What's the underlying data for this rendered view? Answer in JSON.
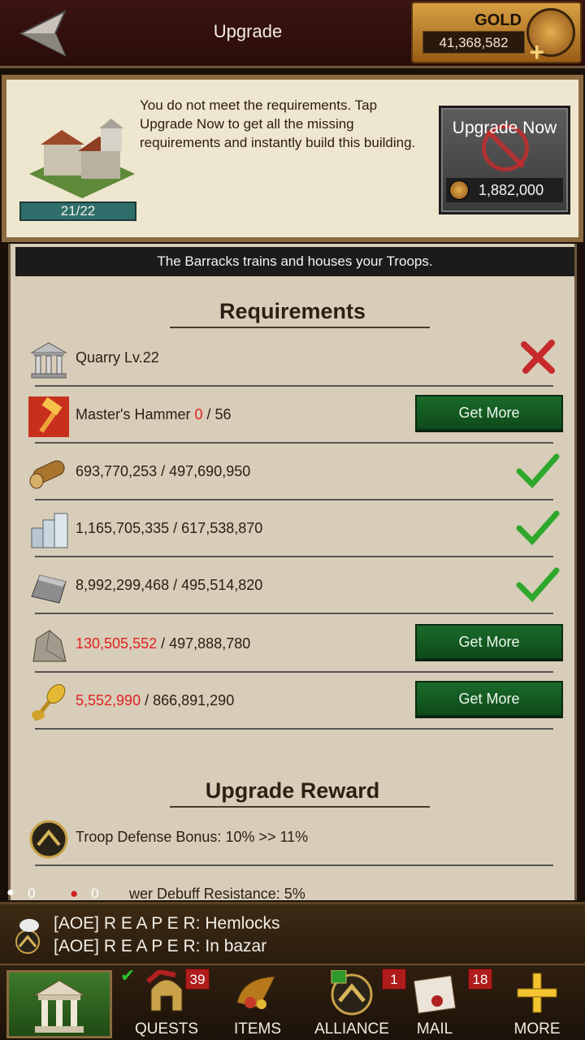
{
  "header": {
    "title": "Upgrade",
    "currency_label": "GOLD",
    "currency_amount": "41,368,582"
  },
  "building": {
    "progress_text": "21/22",
    "progress_fraction": 0.95,
    "notice": "You do not meet the requirements. Tap Upgrade Now to get all the missing requirements and instantly build this building.",
    "upgrade_now_label": "Upgrade Now",
    "upgrade_now_cost": "1,882,000"
  },
  "description": "The Barracks trains and houses your Troops.",
  "requirements": {
    "title": "Requirements",
    "items": [
      {
        "name": "quarry",
        "text": "Quarry Lv.22",
        "status": "missing"
      },
      {
        "name": "masters-hammer",
        "label": "Master's Hammer",
        "have": "0",
        "need": "56",
        "have_red": true,
        "action": "Get More"
      },
      {
        "name": "wood",
        "have": "693,770,253",
        "need": "497,690,950",
        "status": "met"
      },
      {
        "name": "silver",
        "have": "1,165,705,335",
        "need": "617,538,870",
        "status": "met"
      },
      {
        "name": "iron",
        "have": "8,992,299,468",
        "need": "495,514,820",
        "status": "met"
      },
      {
        "name": "stone",
        "have": "130,505,552",
        "need": "497,888,780",
        "have_red": true,
        "action": "Get More"
      },
      {
        "name": "food",
        "have": "5,552,990",
        "need": "866,891,290",
        "have_red": true,
        "action": "Get More"
      }
    ]
  },
  "reward": {
    "title": "Upgrade Reward",
    "items": [
      {
        "text": "Troop Defense Bonus: 10% >> 11%"
      },
      {
        "text": "wer Debuff Resistance: 5%"
      }
    ]
  },
  "status_strip": {
    "left_count": "0",
    "right_count": "0"
  },
  "chat": {
    "lines": [
      "[AOE] R E A P E R: Hemlocks",
      "[AOE] R E A P E R: In bazar"
    ]
  },
  "nav": {
    "items": [
      {
        "label": "QUESTS",
        "badge": "39"
      },
      {
        "label": "ITEMS",
        "badge": ""
      },
      {
        "label": "ALLIANCE",
        "badge": "1"
      },
      {
        "label": "MAIL",
        "badge": "18"
      },
      {
        "label": "MORE",
        "badge": ""
      }
    ]
  },
  "colors": {
    "accent_green": "#1a6b2a",
    "warning_red": "#e02222",
    "gold": "#d7a042"
  },
  "icons": [
    "back-arrow-icon",
    "gold-coin-icon",
    "plus-icon",
    "building-icon",
    "no-entry-icon",
    "quarry-icon",
    "hammer-icon",
    "wood-icon",
    "silver-icon",
    "iron-icon",
    "stone-icon",
    "food-icon",
    "check-icon",
    "x-icon",
    "spartan-helmet-icon",
    "chat-icon"
  ]
}
